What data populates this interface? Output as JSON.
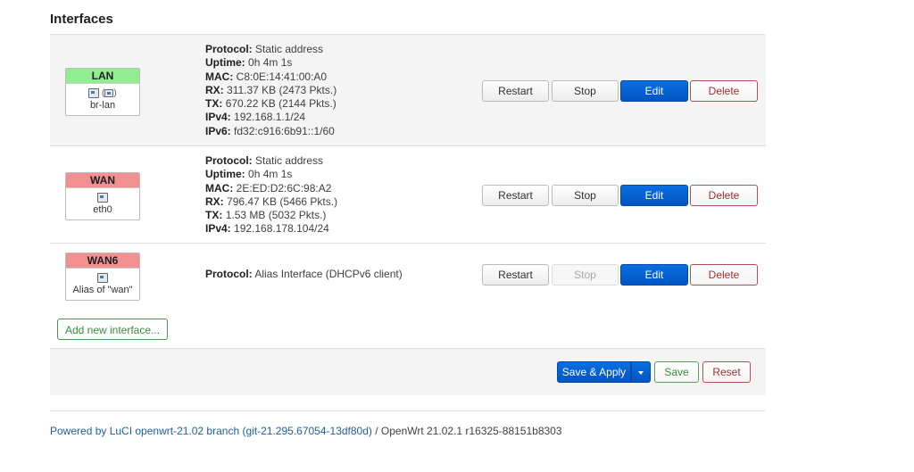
{
  "page": {
    "title": "Interfaces"
  },
  "interfaces": [
    {
      "name": "LAN",
      "device": "br-lan",
      "color": "#90ee90",
      "icons": [
        "network-icon",
        "bridge-icon"
      ],
      "info": [
        {
          "label": "Protocol:",
          "value": "Static address"
        },
        {
          "label": "Uptime:",
          "value": "0h 4m 1s"
        },
        {
          "label": "MAC:",
          "value": "C8:0E:14:41:00:A0"
        },
        {
          "label": "RX:",
          "value": "311.37 KB (2473 Pkts.)"
        },
        {
          "label": "TX:",
          "value": "670.22 KB (2144 Pkts.)"
        },
        {
          "label": "IPv4:",
          "value": "192.168.1.1/24"
        },
        {
          "label": "IPv6:",
          "value": "fd32:c916:6b91::1/60"
        }
      ]
    },
    {
      "name": "WAN",
      "device": "eth0",
      "color": "#f09090",
      "icons": [
        "ethernet-port-icon"
      ],
      "info": [
        {
          "label": "Protocol:",
          "value": "Static address"
        },
        {
          "label": "Uptime:",
          "value": "0h 4m 1s"
        },
        {
          "label": "MAC:",
          "value": "2E:ED:D2:6C:98:A2"
        },
        {
          "label": "RX:",
          "value": "796.47 KB (5466 Pkts.)"
        },
        {
          "label": "TX:",
          "value": "1.53 MB (5032 Pkts.)"
        },
        {
          "label": "IPv4:",
          "value": "192.168.178.104/24"
        }
      ]
    },
    {
      "name": "WAN6",
      "device": "Alias of \"wan\"",
      "color": "#f09090",
      "icons": [
        "alias-icon"
      ],
      "info": [
        {
          "label": "Protocol:",
          "value": "Alias Interface (DHCPv6 client)"
        }
      ]
    }
  ],
  "buttons": {
    "restart": "Restart",
    "stop": "Stop",
    "edit": "Edit",
    "delete": "Delete",
    "add_interface": "Add new interface...",
    "save_apply": "Save & Apply",
    "save": "Save",
    "reset": "Reset"
  },
  "footer": {
    "powered_by": "Powered by LuCI openwrt-21.02 branch (git-21.295.67054-13df80d)",
    "separator": " / ",
    "version": "OpenWrt 21.02.1 r16325-88151b8303"
  },
  "colors": {
    "primary": "#0060d0",
    "negative": "#a03030",
    "positive": "#3a8a3a",
    "link": "#2060a0"
  }
}
